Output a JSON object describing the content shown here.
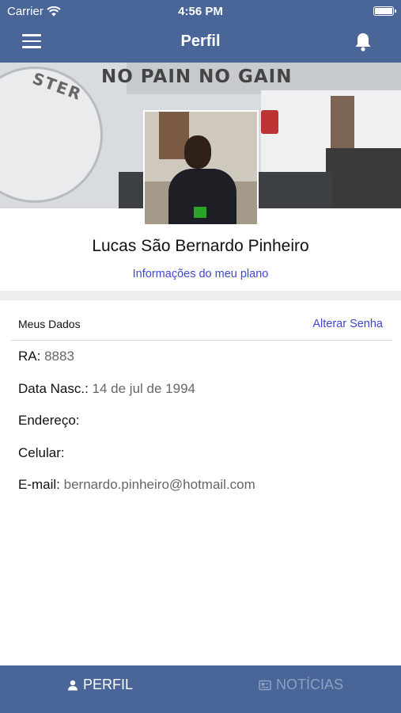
{
  "status_bar": {
    "carrier": "Carrier",
    "time": "4:56 PM"
  },
  "nav": {
    "title": "Perfil"
  },
  "cover": {
    "banner_text": "NO PAIN  NO GAIN",
    "logo_text": "STER"
  },
  "profile": {
    "name": "Lucas São Bernardo Pinheiro",
    "plan_link": "Informações do meu plano"
  },
  "data_section": {
    "title": "Meus Dados",
    "action": "Alterar Senha",
    "fields": [
      {
        "label": "RA:",
        "value": "8883"
      },
      {
        "label": "Data Nasc.:",
        "value": "14 de jul de 1994"
      },
      {
        "label": "Endereço:",
        "value": ""
      },
      {
        "label": "Celular:",
        "value": ""
      },
      {
        "label": "E-mail:",
        "value": "bernardo.pinheiro@hotmail.com"
      }
    ]
  },
  "tabs": [
    {
      "label": "PERFIL",
      "icon": "person-icon",
      "active": true
    },
    {
      "label": "NOTÍCIAS",
      "icon": "newspaper-icon",
      "active": false
    }
  ],
  "colors": {
    "primary": "#4a6597",
    "link": "#3f47d6",
    "inactive_tab": "#8fa0c0"
  }
}
